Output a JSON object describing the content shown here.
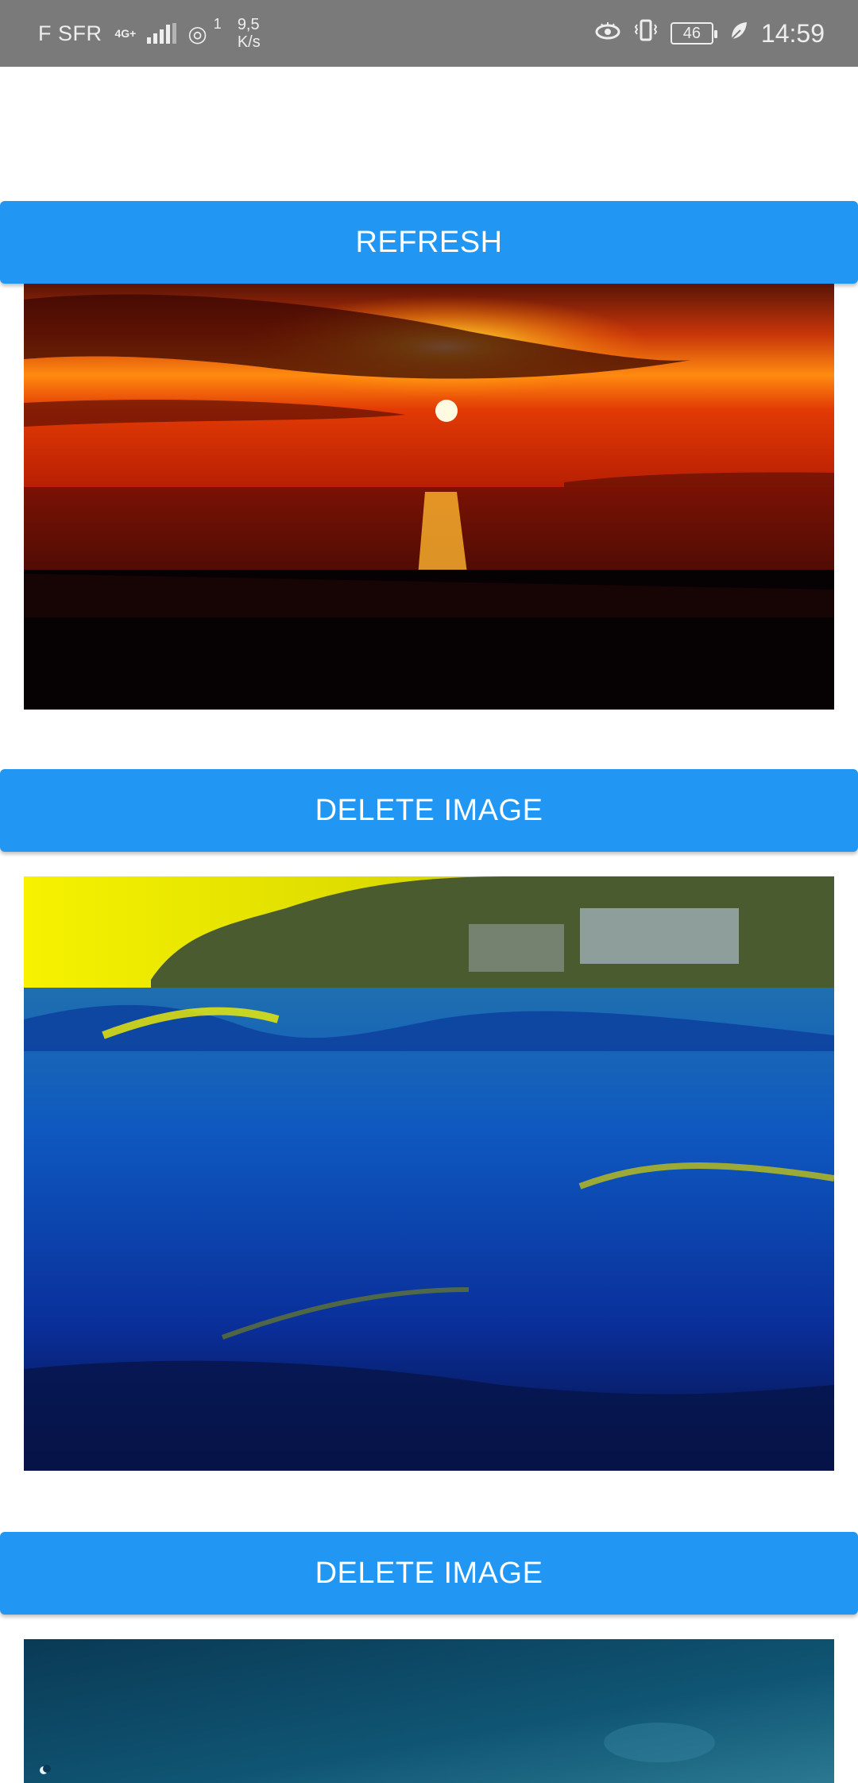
{
  "status_bar": {
    "carrier": "F SFR",
    "network_type": "4G+",
    "hotspot_count": "1",
    "speed_value": "9,5",
    "speed_unit": "K/s",
    "battery": "46",
    "time": "14:59",
    "icons": [
      "signal-icon",
      "hotspot-icon",
      "eye-comfort-icon",
      "vibrate-icon",
      "battery-icon",
      "power-saving-leaf-icon"
    ]
  },
  "refresh_label": "REFRESH",
  "images": [
    {
      "delete_label": "DELETE IMAGE",
      "subject": "sunset-over-sea"
    },
    {
      "delete_label": "DELETE IMAGE",
      "subject": "ocean-waves-coast"
    },
    {
      "subject": "night-sky"
    }
  ],
  "colors": {
    "button": "#2196f3",
    "button_text": "#ffffff",
    "status_bar": "#7a7a7a"
  }
}
